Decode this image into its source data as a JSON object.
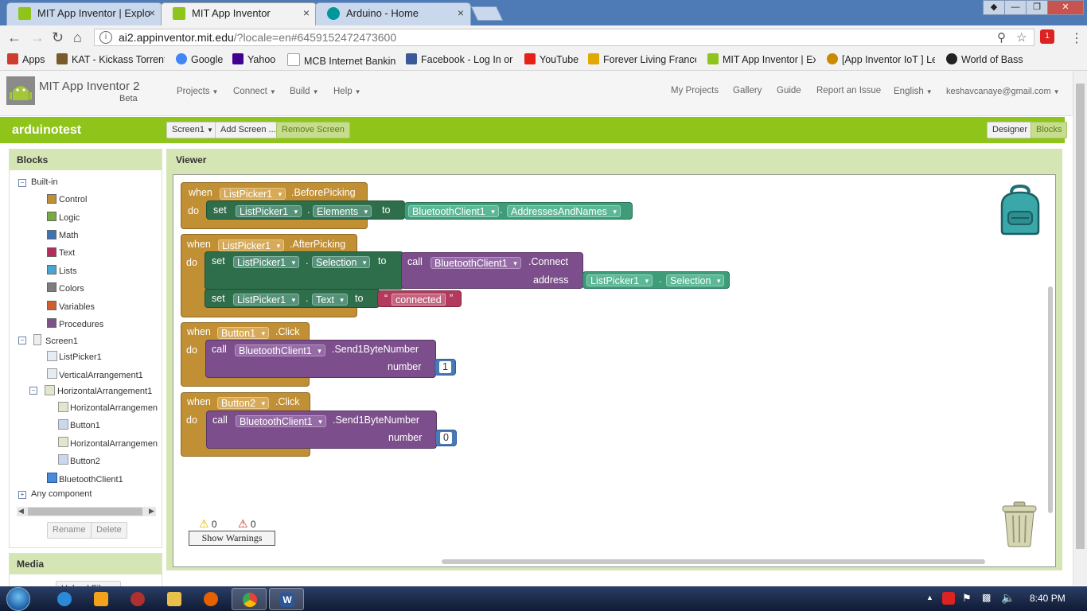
{
  "browser": {
    "tabs": [
      {
        "title": "MIT App Inventor | Explo",
        "icon_color": "#8fc41a"
      },
      {
        "title": "MIT App Inventor",
        "icon_color": "#8fc41a"
      },
      {
        "title": "Arduino - Home",
        "icon_color": "#00979c"
      }
    ],
    "close_glyph": "×",
    "url_host": "ai2.appinventor.mit.edu",
    "url_path": "/?locale=en#6459152472473600",
    "bookmarks": [
      {
        "label": "Apps",
        "icon_color": "#d03b2f"
      },
      {
        "label": "KAT - Kickass Torrents",
        "icon_color": "#7a5c2a"
      },
      {
        "label": "Google",
        "icon_color": "#4285f4"
      },
      {
        "label": "Yahoo",
        "icon_color": "#400090"
      },
      {
        "label": "MCB Internet Banking",
        "icon_color": "#9aa0a6"
      },
      {
        "label": "Facebook - Log In or S",
        "icon_color": "#3b5998"
      },
      {
        "label": "YouTube",
        "icon_color": "#e62117"
      },
      {
        "label": "Forever Living France",
        "icon_color": "#e0a800"
      },
      {
        "label": "MIT App Inventor | Exp",
        "icon_color": "#8fc41a"
      },
      {
        "label": "[App Inventor IoT ] Le",
        "icon_color": "#c98a00"
      },
      {
        "label": "World of Bass",
        "icon_color": "#222222"
      }
    ]
  },
  "app": {
    "title": "MIT App Inventor 2",
    "beta": "Beta",
    "menus": [
      "Projects",
      "Connect",
      "Build",
      "Help"
    ],
    "right_links": [
      "My Projects",
      "Gallery",
      "Guide",
      "Report an Issue",
      "English",
      "keshavcanaye@gmail.com"
    ],
    "project_name": "arduinotest",
    "screen_selector": "Screen1",
    "add_screen": "Add Screen ...",
    "remove_screen": "Remove Screen",
    "designer": "Designer",
    "blocks_btn": "Blocks"
  },
  "blocks_panel": {
    "title": "Blocks",
    "builtin": "Built-in",
    "builtin_items": [
      {
        "label": "Control",
        "color": "#c18f34"
      },
      {
        "label": "Logic",
        "color": "#77ab41"
      },
      {
        "label": "Math",
        "color": "#3f71b5"
      },
      {
        "label": "Text",
        "color": "#b32d5e"
      },
      {
        "label": "Lists",
        "color": "#49a6d4"
      },
      {
        "label": "Colors",
        "color": "#7d7d7d"
      },
      {
        "label": "Variables",
        "color": "#d05f2d"
      },
      {
        "label": "Procedures",
        "color": "#7c5385"
      }
    ],
    "screen": "Screen1",
    "components": [
      {
        "label": "ListPicker1",
        "indent": 1
      },
      {
        "label": "VerticalArrangement1",
        "indent": 1
      },
      {
        "label": "HorizontalArrangement1",
        "indent": 1
      },
      {
        "label": "HorizontalArrangemen",
        "indent": 2
      },
      {
        "label": "Button1",
        "indent": 2
      },
      {
        "label": "HorizontalArrangemen",
        "indent": 2
      },
      {
        "label": "Button2",
        "indent": 2
      },
      {
        "label": "BluetoothClient1",
        "indent": 1
      }
    ],
    "any_component": "Any component",
    "rename": "Rename",
    "delete": "Delete"
  },
  "media_panel": {
    "title": "Media",
    "upload": "Upload File ..."
  },
  "viewer": {
    "title": "Viewer",
    "kw_when": "when",
    "kw_do": "do",
    "kw_set": "set",
    "kw_to": "to",
    "kw_call": "call",
    "dot": ".",
    "quote_open": "“",
    "quote_close": "”",
    "b1": {
      "component": "ListPicker1",
      "event": ".BeforePicking",
      "set_comp": "ListPicker1",
      "set_prop": "Elements",
      "get_comp": "BluetoothClient1",
      "get_prop": "AddressesAndNames"
    },
    "b2": {
      "component": "ListPicker1",
      "event": ".AfterPicking",
      "set1_comp": "ListPicker1",
      "set1_prop": "Selection",
      "call_comp": "BluetoothClient1",
      "call_method": ".Connect",
      "arg_label": "address",
      "arg_comp": "ListPicker1",
      "arg_prop": "Selection",
      "set2_comp": "ListPicker1",
      "set2_prop": "Text",
      "text_value": "connected"
    },
    "b3": {
      "component": "Button1",
      "event": ".Click",
      "call_comp": "BluetoothClient1",
      "call_method": ".Send1ByteNumber",
      "arg_label": "number",
      "number": "1"
    },
    "b4": {
      "component": "Button2",
      "event": ".Click",
      "call_comp": "BluetoothClient1",
      "call_method": ".Send1ByteNumber",
      "arg_label": "number",
      "number": "0"
    },
    "warnings_count": "0",
    "errors_count": "0",
    "show_warnings": "Show Warnings"
  },
  "taskbar": {
    "apps": [
      {
        "name": "internet-explorer",
        "color": "#2a8ad8"
      },
      {
        "name": "media-player",
        "color": "#f2a21b"
      },
      {
        "name": "game-app",
        "color": "#b03030"
      },
      {
        "name": "file-explorer",
        "color": "#e8c04a"
      },
      {
        "name": "firefox",
        "color": "#e66000"
      },
      {
        "name": "chrome",
        "color": "#34a853"
      },
      {
        "name": "word",
        "color": "#2b579a"
      }
    ],
    "time": "8:40 PM"
  }
}
